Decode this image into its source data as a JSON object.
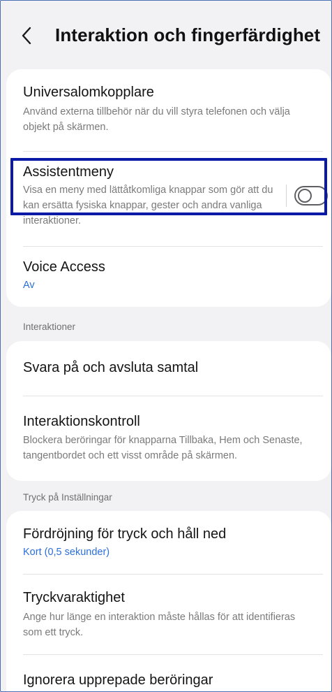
{
  "header": {
    "title": "Interaktion och fingerfärdighet",
    "back_icon": "chevron-left-icon"
  },
  "items": [
    {
      "title": "Universalomkopplare",
      "subtitle": "Använd externa tillbehör när du vill styra telefonen och välja objekt på skärmen."
    },
    {
      "title": "Assistentmeny",
      "subtitle": "Visa en meny med lättåtkomliga knappar som gör att du kan ersätta fysiska knappar, gester och andra vanliga interaktioner.",
      "toggle_on": false
    },
    {
      "title": "Voice Access",
      "value": "Av"
    }
  ],
  "sections": [
    {
      "label": "Interaktioner",
      "items": [
        {
          "title": "Svara på och avsluta samtal"
        },
        {
          "title": "Interaktionskontroll",
          "subtitle": "Blockera beröringar för knapparna Tillbaka, Hem och Senaste, tangentbordet och ett visst område på skärmen."
        }
      ]
    },
    {
      "label": "Tryck på Inställningar",
      "items": [
        {
          "title": "Fördröjning för tryck och håll ned",
          "value": "Kort (0,5 sekunder)"
        },
        {
          "title": "Tryckvaraktighet",
          "subtitle": "Ange hur länge en interaktion måste hållas för att identifieras som ett tryck."
        },
        {
          "title": "Ignorera upprepade beröringar"
        }
      ]
    }
  ],
  "colors": {
    "accent_value": "#2a6fdb",
    "highlight_border": "#0a1aa6",
    "background": "#f2f2f4"
  }
}
